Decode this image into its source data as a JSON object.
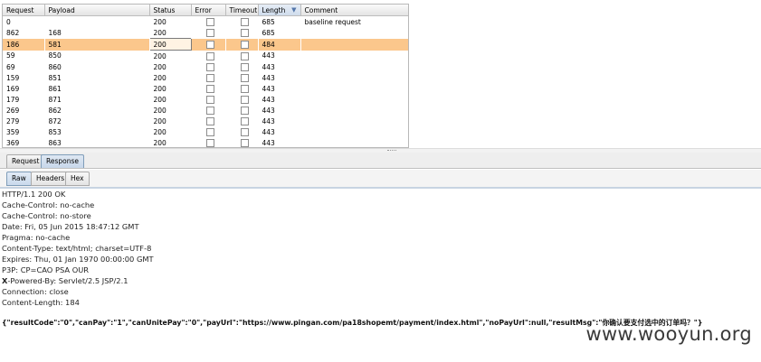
{
  "table": {
    "columns": [
      "Request",
      "Payload",
      "Status",
      "Error",
      "Timeout",
      "Length",
      "Comment"
    ],
    "rows": [
      {
        "request": "0",
        "payload": "",
        "status": "200",
        "length": "685",
        "comment": "baseline request"
      },
      {
        "request": "862",
        "payload": "168",
        "status": "200",
        "length": "685",
        "comment": ""
      },
      {
        "request": "186",
        "payload": "581",
        "status": "200",
        "length": "484",
        "comment": ""
      },
      {
        "request": "59",
        "payload": "850",
        "status": "200",
        "length": "443",
        "comment": ""
      },
      {
        "request": "69",
        "payload": "860",
        "status": "200",
        "length": "443",
        "comment": ""
      },
      {
        "request": "159",
        "payload": "851",
        "status": "200",
        "length": "443",
        "comment": ""
      },
      {
        "request": "169",
        "payload": "861",
        "status": "200",
        "length": "443",
        "comment": ""
      },
      {
        "request": "179",
        "payload": "871",
        "status": "200",
        "length": "443",
        "comment": ""
      },
      {
        "request": "269",
        "payload": "862",
        "status": "200",
        "length": "443",
        "comment": ""
      },
      {
        "request": "279",
        "payload": "872",
        "status": "200",
        "length": "443",
        "comment": ""
      },
      {
        "request": "359",
        "payload": "853",
        "status": "200",
        "length": "443",
        "comment": ""
      },
      {
        "request": "369",
        "payload": "863",
        "status": "200",
        "length": "443",
        "comment": ""
      }
    ],
    "selected_request": "186",
    "sort_icon": "sort-desc-icon"
  },
  "main_tabs": {
    "request": "Request",
    "response": "Response",
    "active": "Response"
  },
  "sub_tabs": {
    "raw": "Raw",
    "headers": "Headers",
    "hex": "Hex",
    "active": "Raw"
  },
  "response_headers": [
    {
      "bold": "",
      "rest": "HTTP/1.1 200 OK"
    },
    {
      "bold": "",
      "rest": "Cache-Control: no-cache"
    },
    {
      "bold": "",
      "rest": "Cache-Control: no-store"
    },
    {
      "bold": "",
      "rest": "Date: Fri, 05 Jun 2015 18:47:12 GMT"
    },
    {
      "bold": "",
      "rest": "Pragma: no-cache"
    },
    {
      "bold": "",
      "rest": "Content-Type: text/html; charset=UTF-8"
    },
    {
      "bold": "",
      "rest": "Expires: Thu, 01 Jan 1970 00:00:00 GMT"
    },
    {
      "bold": "",
      "rest": "P3P: CP=CAO PSA OUR"
    },
    {
      "bold": "X",
      "rest": "-Powered-By: Servlet/2.5 JSP/2.1"
    },
    {
      "bold": "",
      "rest": "Connection: close"
    },
    {
      "bold": "",
      "rest": "Content-Length: 184"
    }
  ],
  "response_body": "{\"resultCode\":\"0\",\"canPay\":\"1\",\"canUnitePay\":\"0\",\"payUrl\":\"https://www.pingan.com/pa18shopemt/payment/index.html\",\"noPayUrl\":null,\"resultMsg\":\"你确认要支付选中的订单吗？\"}",
  "watermark": "www.wooyun.org",
  "colors": {
    "selected_row": "#fbc78c",
    "active_tab": "#c7d7ea"
  }
}
